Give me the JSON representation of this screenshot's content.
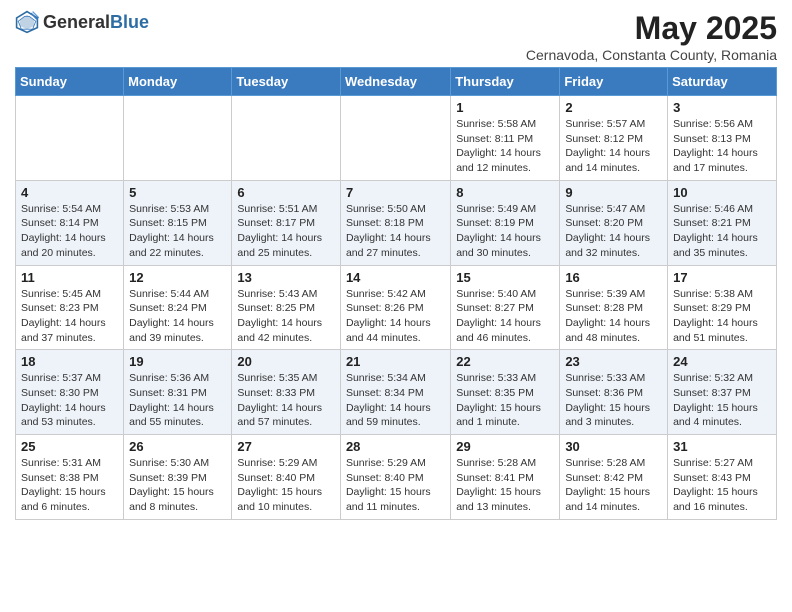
{
  "header": {
    "logo_general": "General",
    "logo_blue": "Blue",
    "title": "May 2025",
    "subtitle": "Cernavoda, Constanta County, Romania"
  },
  "columns": [
    "Sunday",
    "Monday",
    "Tuesday",
    "Wednesday",
    "Thursday",
    "Friday",
    "Saturday"
  ],
  "weeks": [
    [
      {
        "day": "",
        "info": ""
      },
      {
        "day": "",
        "info": ""
      },
      {
        "day": "",
        "info": ""
      },
      {
        "day": "",
        "info": ""
      },
      {
        "day": "1",
        "info": "Sunrise: 5:58 AM\nSunset: 8:11 PM\nDaylight: 14 hours\nand 12 minutes."
      },
      {
        "day": "2",
        "info": "Sunrise: 5:57 AM\nSunset: 8:12 PM\nDaylight: 14 hours\nand 14 minutes."
      },
      {
        "day": "3",
        "info": "Sunrise: 5:56 AM\nSunset: 8:13 PM\nDaylight: 14 hours\nand 17 minutes."
      }
    ],
    [
      {
        "day": "4",
        "info": "Sunrise: 5:54 AM\nSunset: 8:14 PM\nDaylight: 14 hours\nand 20 minutes."
      },
      {
        "day": "5",
        "info": "Sunrise: 5:53 AM\nSunset: 8:15 PM\nDaylight: 14 hours\nand 22 minutes."
      },
      {
        "day": "6",
        "info": "Sunrise: 5:51 AM\nSunset: 8:17 PM\nDaylight: 14 hours\nand 25 minutes."
      },
      {
        "day": "7",
        "info": "Sunrise: 5:50 AM\nSunset: 8:18 PM\nDaylight: 14 hours\nand 27 minutes."
      },
      {
        "day": "8",
        "info": "Sunrise: 5:49 AM\nSunset: 8:19 PM\nDaylight: 14 hours\nand 30 minutes."
      },
      {
        "day": "9",
        "info": "Sunrise: 5:47 AM\nSunset: 8:20 PM\nDaylight: 14 hours\nand 32 minutes."
      },
      {
        "day": "10",
        "info": "Sunrise: 5:46 AM\nSunset: 8:21 PM\nDaylight: 14 hours\nand 35 minutes."
      }
    ],
    [
      {
        "day": "11",
        "info": "Sunrise: 5:45 AM\nSunset: 8:23 PM\nDaylight: 14 hours\nand 37 minutes."
      },
      {
        "day": "12",
        "info": "Sunrise: 5:44 AM\nSunset: 8:24 PM\nDaylight: 14 hours\nand 39 minutes."
      },
      {
        "day": "13",
        "info": "Sunrise: 5:43 AM\nSunset: 8:25 PM\nDaylight: 14 hours\nand 42 minutes."
      },
      {
        "day": "14",
        "info": "Sunrise: 5:42 AM\nSunset: 8:26 PM\nDaylight: 14 hours\nand 44 minutes."
      },
      {
        "day": "15",
        "info": "Sunrise: 5:40 AM\nSunset: 8:27 PM\nDaylight: 14 hours\nand 46 minutes."
      },
      {
        "day": "16",
        "info": "Sunrise: 5:39 AM\nSunset: 8:28 PM\nDaylight: 14 hours\nand 48 minutes."
      },
      {
        "day": "17",
        "info": "Sunrise: 5:38 AM\nSunset: 8:29 PM\nDaylight: 14 hours\nand 51 minutes."
      }
    ],
    [
      {
        "day": "18",
        "info": "Sunrise: 5:37 AM\nSunset: 8:30 PM\nDaylight: 14 hours\nand 53 minutes."
      },
      {
        "day": "19",
        "info": "Sunrise: 5:36 AM\nSunset: 8:31 PM\nDaylight: 14 hours\nand 55 minutes."
      },
      {
        "day": "20",
        "info": "Sunrise: 5:35 AM\nSunset: 8:33 PM\nDaylight: 14 hours\nand 57 minutes."
      },
      {
        "day": "21",
        "info": "Sunrise: 5:34 AM\nSunset: 8:34 PM\nDaylight: 14 hours\nand 59 minutes."
      },
      {
        "day": "22",
        "info": "Sunrise: 5:33 AM\nSunset: 8:35 PM\nDaylight: 15 hours\nand 1 minute."
      },
      {
        "day": "23",
        "info": "Sunrise: 5:33 AM\nSunset: 8:36 PM\nDaylight: 15 hours\nand 3 minutes."
      },
      {
        "day": "24",
        "info": "Sunrise: 5:32 AM\nSunset: 8:37 PM\nDaylight: 15 hours\nand 4 minutes."
      }
    ],
    [
      {
        "day": "25",
        "info": "Sunrise: 5:31 AM\nSunset: 8:38 PM\nDaylight: 15 hours\nand 6 minutes."
      },
      {
        "day": "26",
        "info": "Sunrise: 5:30 AM\nSunset: 8:39 PM\nDaylight: 15 hours\nand 8 minutes."
      },
      {
        "day": "27",
        "info": "Sunrise: 5:29 AM\nSunset: 8:40 PM\nDaylight: 15 hours\nand 10 minutes."
      },
      {
        "day": "28",
        "info": "Sunrise: 5:29 AM\nSunset: 8:40 PM\nDaylight: 15 hours\nand 11 minutes."
      },
      {
        "day": "29",
        "info": "Sunrise: 5:28 AM\nSunset: 8:41 PM\nDaylight: 15 hours\nand 13 minutes."
      },
      {
        "day": "30",
        "info": "Sunrise: 5:28 AM\nSunset: 8:42 PM\nDaylight: 15 hours\nand 14 minutes."
      },
      {
        "day": "31",
        "info": "Sunrise: 5:27 AM\nSunset: 8:43 PM\nDaylight: 15 hours\nand 16 minutes."
      }
    ]
  ]
}
